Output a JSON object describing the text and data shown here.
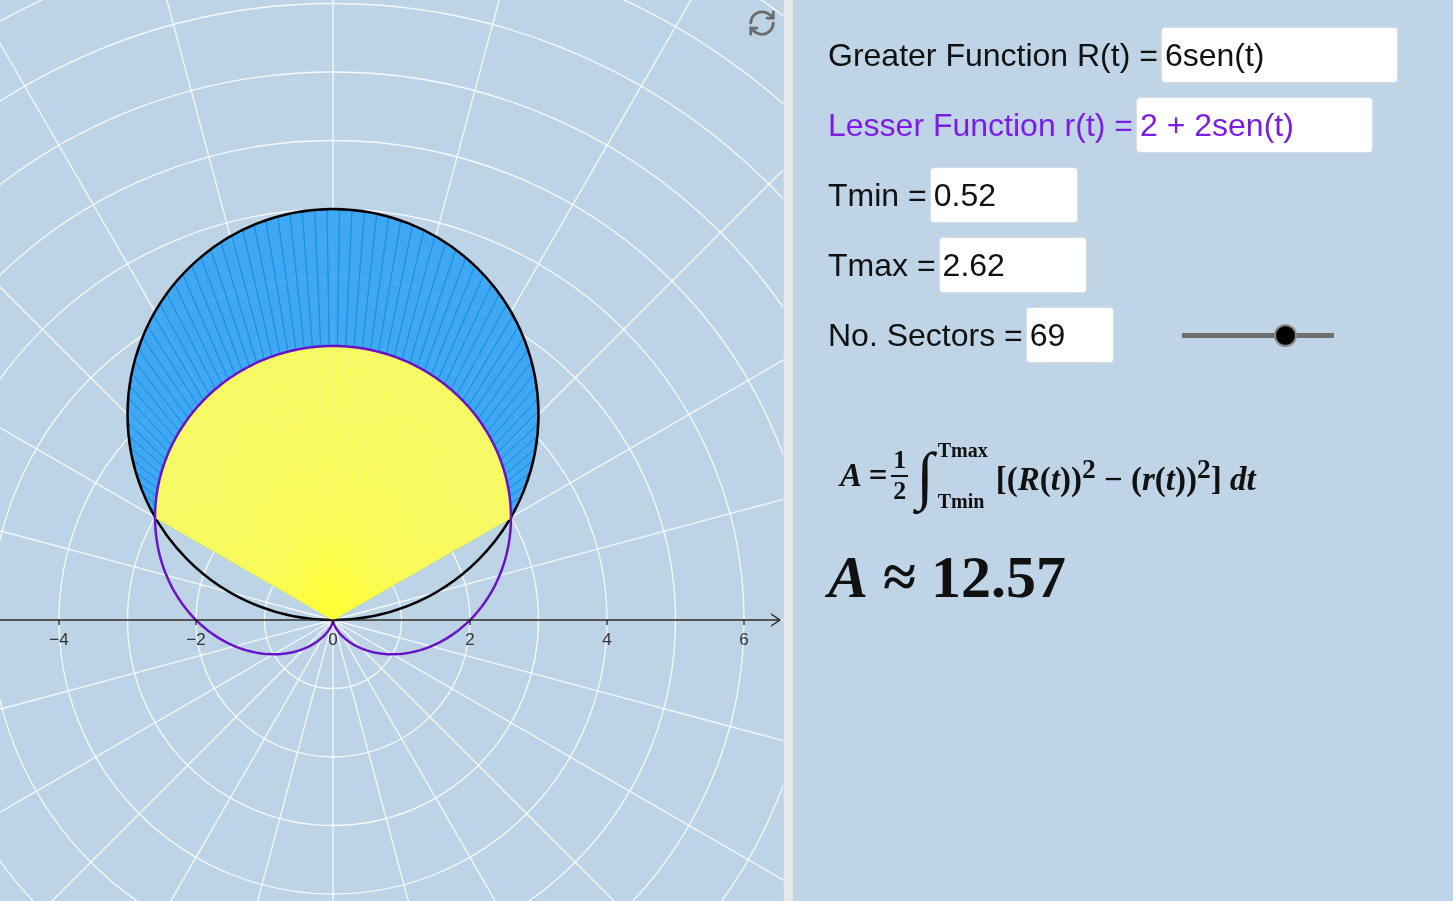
{
  "graph": {
    "x_ticks": [
      "−4",
      "−2",
      "0",
      "2",
      "4",
      "6"
    ]
  },
  "inputs": [
    {
      "kind": "greater",
      "label": "Greater Function R(t) =",
      "value": "6sen(t)"
    },
    {
      "kind": "lesser",
      "label": "Lesser Function r(t) =",
      "value": "2 + 2sen(t)"
    },
    {
      "kind": "plain",
      "label": "Tmin =",
      "value": "0.52"
    },
    {
      "kind": "plain",
      "label": "Tmax =",
      "value": "2.62"
    },
    {
      "kind": "slider",
      "label": "No. Sectors =",
      "value": "69",
      "level": 0.68
    }
  ],
  "formula": {
    "lhs": "A =",
    "numerator": "1",
    "denominator": "2",
    "integral": "∫",
    "upper": "Tmax",
    "lower": "Tmin",
    "integrand": "[(*R*(*t*))$^{2}$ − (*r*(*t*))$^{2}$] *dt*"
  },
  "result": "*A* ≈ 12.57"
}
